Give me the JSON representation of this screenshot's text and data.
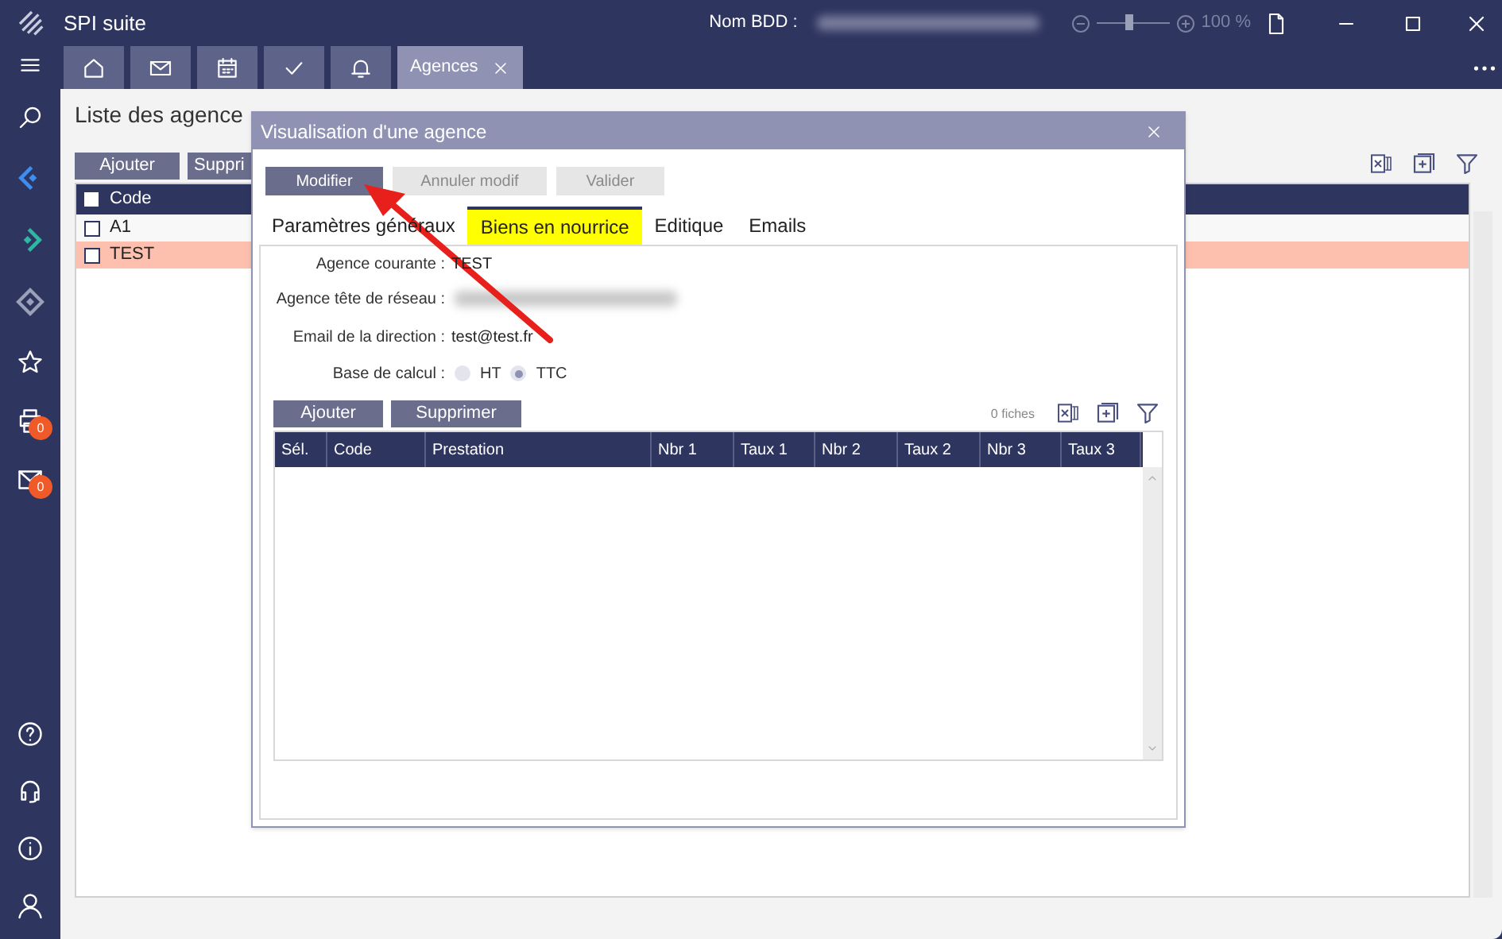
{
  "window": {
    "title": "SPI suite",
    "db_label": "Nom BDD :",
    "zoom_reading": "100 %",
    "zoom": {
      "level": 0.45
    }
  },
  "tabs": [
    {
      "kind": "home",
      "selected": false
    },
    {
      "kind": "mail",
      "selected": false
    },
    {
      "kind": "calendar",
      "selected": false
    },
    {
      "kind": "check",
      "selected": false
    },
    {
      "kind": "bell",
      "selected": false
    },
    {
      "kind": "text",
      "label": "Agences",
      "selected": true
    }
  ],
  "sidebar": {
    "items": [
      {
        "kind": "search"
      },
      {
        "kind": "left"
      },
      {
        "kind": "right"
      },
      {
        "kind": "diamond"
      },
      {
        "kind": "star"
      },
      {
        "kind": "printer",
        "badge": "0"
      },
      {
        "kind": "mail",
        "badge": "0"
      }
    ],
    "bottom_items": [
      {
        "kind": "help"
      },
      {
        "kind": "headset"
      },
      {
        "kind": "info"
      },
      {
        "kind": "user"
      }
    ]
  },
  "page": {
    "title": "Liste des agence",
    "buttons": [
      "Ajouter",
      "Suppri"
    ],
    "table": {
      "header_checked": false,
      "columns": [
        "Code"
      ],
      "rows": [
        {
          "code": "A1",
          "checked": false,
          "selected": false
        },
        {
          "code": "TEST",
          "checked": false,
          "selected": true
        }
      ]
    }
  },
  "dialog": {
    "title": "Visualisation d'une agence",
    "buttons": [
      {
        "label": "Modifier",
        "disabled": false
      },
      {
        "label": "Annuler modif",
        "disabled": true
      },
      {
        "label": "Valider",
        "disabled": true
      }
    ],
    "tabs": [
      {
        "label": "Paramètres généraux",
        "selected": false
      },
      {
        "label": "Biens en nourrice",
        "selected": true
      },
      {
        "label": "Editique",
        "selected": false
      },
      {
        "label": "Emails",
        "selected": false
      }
    ],
    "fields": [
      {
        "kind": "text",
        "label": "Agence courante :",
        "value": "TEST"
      },
      {
        "kind": "redacted",
        "label": "Agence tête de réseau :"
      },
      {
        "kind": "text",
        "label": "Email de la direction :",
        "value": "test@test.fr"
      }
    ],
    "radio": {
      "label": "Base de calcul :",
      "options": [
        {
          "label": "HT",
          "selected": false
        },
        {
          "label": "TTC",
          "selected": true
        }
      ]
    },
    "grid_buttons": [
      "Ajouter",
      "Supprimer"
    ],
    "count": "0 fiches",
    "grid_columns": [
      "Sél.",
      "Code",
      "Prestation",
      "Nbr 1",
      "Taux 1",
      "Nbr 2",
      "Taux 2",
      "Nbr 3",
      "Taux 3"
    ]
  }
}
